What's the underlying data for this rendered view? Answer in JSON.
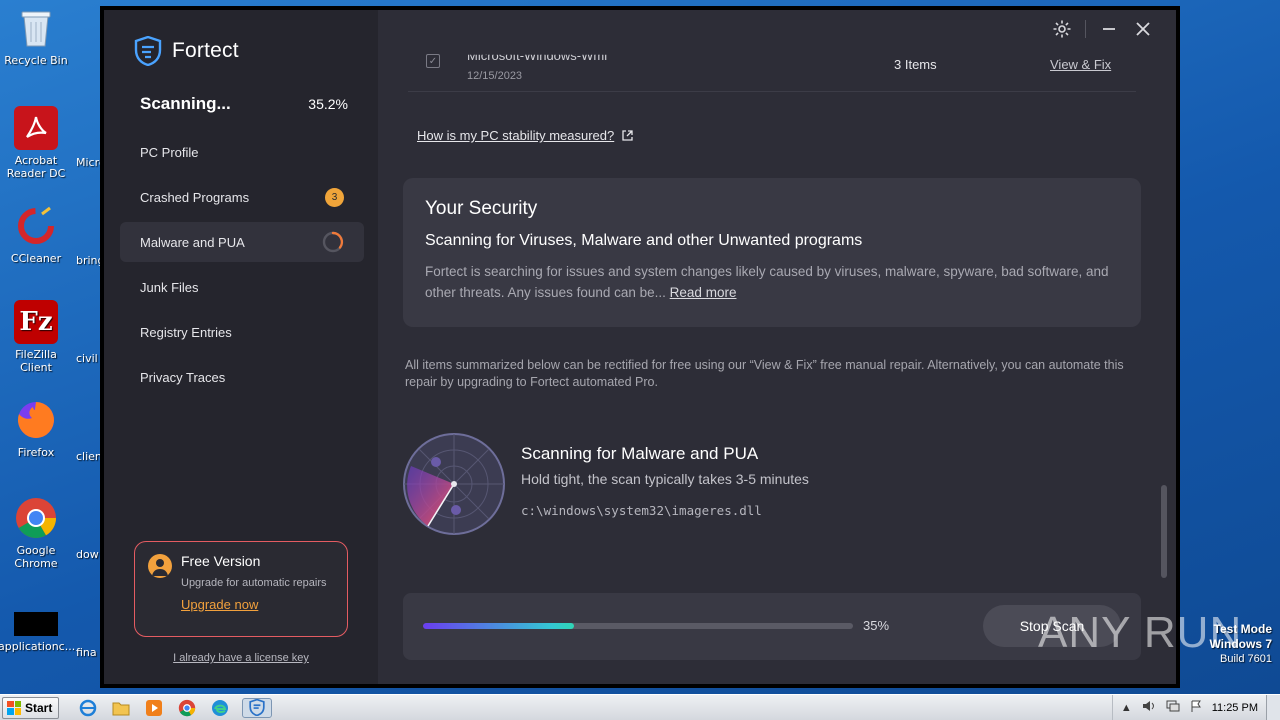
{
  "desktop": {
    "icons": [
      {
        "name": "recycle-bin-icon",
        "label": "Recycle Bin"
      },
      {
        "name": "acrobat-icon",
        "label": "Acrobat Reader DC"
      },
      {
        "name": "ccleaner-icon",
        "label": "CCleaner"
      },
      {
        "name": "filezilla-icon",
        "label": "FileZilla Client"
      },
      {
        "name": "firefox-icon",
        "label": "Firefox"
      },
      {
        "name": "chrome-icon",
        "label": "Google Chrome"
      },
      {
        "name": "application-icon",
        "label": "applicationc..."
      }
    ],
    "partial_labels": [
      "Micro",
      "bring",
      "civil",
      "clien",
      "dow",
      "fina"
    ],
    "watermark": {
      "line1": "Test Mode",
      "line2": "Windows 7",
      "line3": "Build 7601"
    }
  },
  "taskbar": {
    "start_label": "Start",
    "clock": "11:25 PM"
  },
  "app": {
    "brand": "Fortect",
    "accent": "#f2a13d",
    "sidebar": {
      "status_label": "Scanning...",
      "status_pct": "35.2%",
      "items": [
        {
          "label": "PC Profile"
        },
        {
          "label": "Crashed Programs",
          "badge": "3"
        },
        {
          "label": "Malware and PUA"
        },
        {
          "label": "Junk Files"
        },
        {
          "label": "Registry Entries"
        },
        {
          "label": "Privacy Traces"
        }
      ],
      "free_card": {
        "title": "Free Version",
        "subtitle": "Upgrade for automatic repairs",
        "link": "Upgrade now"
      },
      "license_link": "I already have a license key"
    },
    "main": {
      "prev_row": {
        "name": "Microsoft-Windows-Wmi",
        "date": "12/15/2023",
        "count": "3 Items",
        "link": "View & Fix"
      },
      "stability_link": "How is my PC stability measured?",
      "security": {
        "title": "Your Security",
        "subtitle": "Scanning for Viruses, Malware and other Unwanted programs",
        "description": "Fortect is searching for issues and system changes likely caused by viruses, malware, spyware, bad software, and other threats. Any issues found can be...",
        "read_more": "Read more"
      },
      "summary": "All items summarized below can be rectified for free using our “View & Fix” free manual repair. Alternatively, you can automate this repair by upgrading to Fortect automated Pro.",
      "scan": {
        "title": "Scanning for Malware and PUA",
        "hint": "Hold tight, the scan typically takes 3-5 minutes",
        "path": "c:\\windows\\system32\\imageres.dll"
      },
      "progress": {
        "value": 35,
        "label": "35%",
        "stop_label": "Stop Scan"
      }
    }
  },
  "overlay": {
    "brand_text": "ANY RUN"
  }
}
